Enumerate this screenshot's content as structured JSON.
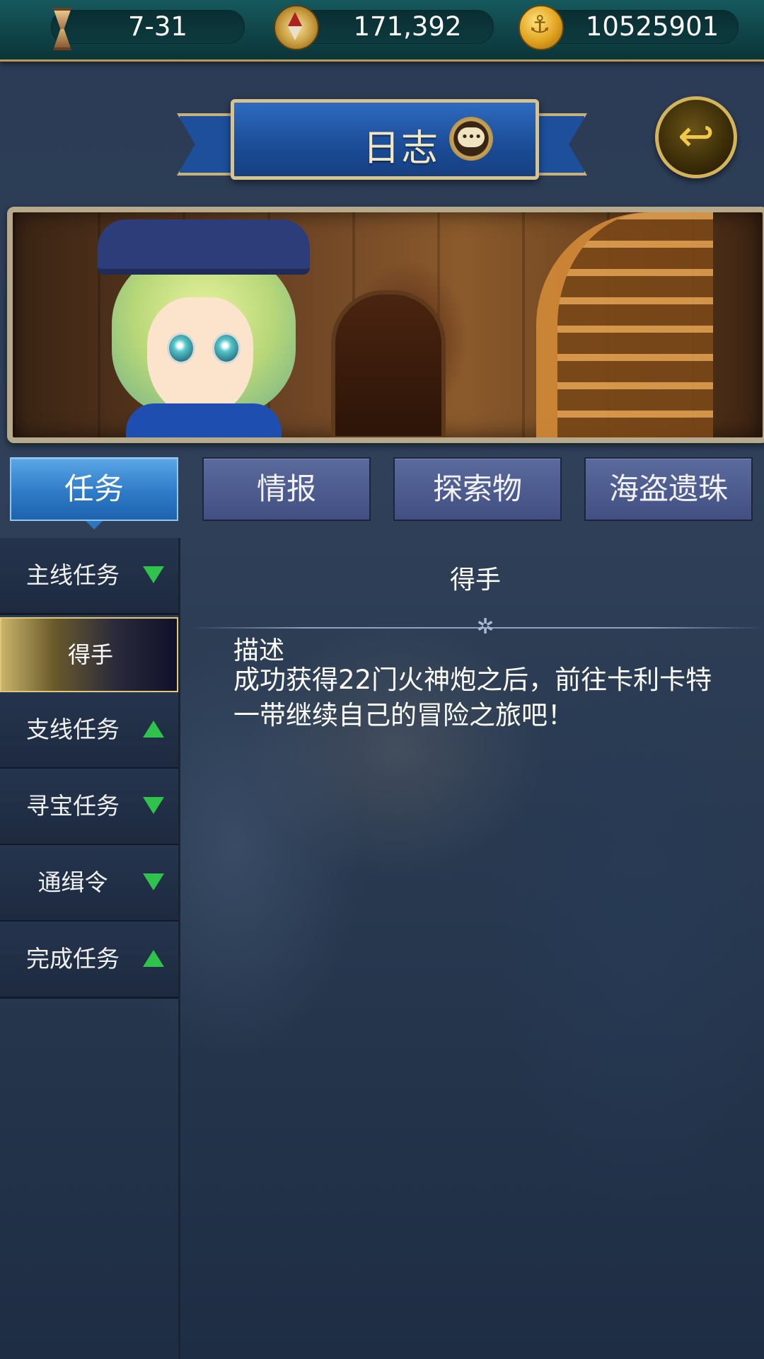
{
  "resources": {
    "time": {
      "value": "7-31",
      "icon": "hourglass-icon"
    },
    "compass": {
      "value": "171,392",
      "icon": "compass-icon"
    },
    "gold": {
      "value": "10525901",
      "icon": "gold-coin-icon"
    }
  },
  "header": {
    "title": "日志",
    "chat_icon": "chat-icon",
    "back_icon": "back-arrow-icon"
  },
  "tabs": [
    {
      "label": "任务",
      "active": true
    },
    {
      "label": "情报",
      "active": false
    },
    {
      "label": "探索物",
      "active": false
    },
    {
      "label": "海盗遗珠",
      "active": false
    }
  ],
  "categories": [
    {
      "label": "主线任务",
      "arrow": "down"
    },
    {
      "label": "得手",
      "selected": true
    },
    {
      "label": "支线任务",
      "arrow": "up"
    },
    {
      "label": "寻宝任务",
      "arrow": "down"
    },
    {
      "label": "通缉令",
      "arrow": "down"
    },
    {
      "label": "完成任务",
      "arrow": "up"
    }
  ],
  "detail": {
    "title": "得手",
    "desc_heading": "描述",
    "desc_text": "成功获得22门火神炮之后，前往卡利卡特一带继续自己的冒险之旅吧！"
  },
  "colors": {
    "accent_tab": "#2f7bc7",
    "arrow_green": "#2fc24c",
    "gold_border": "#d3b35c"
  }
}
